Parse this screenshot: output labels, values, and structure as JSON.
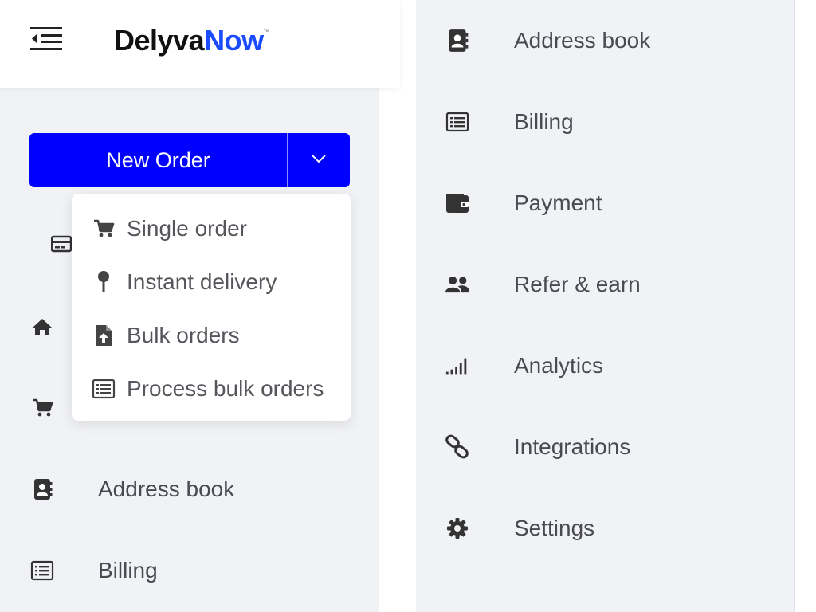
{
  "brand": {
    "part1": "Delyva",
    "part2": "Now",
    "tm": "™",
    "accent": "#1a4bff"
  },
  "new_order": {
    "label": "New Order",
    "bg": "#0000ff"
  },
  "dropdown": {
    "items": [
      {
        "label": "Single order",
        "icon": "cart-icon"
      },
      {
        "label": "Instant delivery",
        "icon": "pin-icon"
      },
      {
        "label": "Bulk orders",
        "icon": "file-upload-icon"
      },
      {
        "label": "Process bulk orders",
        "icon": "list-icon"
      }
    ]
  },
  "sidebar_left": {
    "items": [
      {
        "label": "",
        "icon": "home-icon"
      },
      {
        "label": "",
        "icon": "cart-icon"
      },
      {
        "label": "Address book",
        "icon": "address-book-icon"
      },
      {
        "label": "Billing",
        "icon": "billing-icon"
      }
    ]
  },
  "sidebar_right": {
    "items": [
      {
        "label": "Address book",
        "icon": "address-book-icon"
      },
      {
        "label": "Billing",
        "icon": "billing-icon"
      },
      {
        "label": "Payment",
        "icon": "wallet-icon"
      },
      {
        "label": "Refer & earn",
        "icon": "users-icon"
      },
      {
        "label": "Analytics",
        "icon": "signal-icon"
      },
      {
        "label": "Integrations",
        "icon": "link-icon"
      },
      {
        "label": "Settings",
        "icon": "gear-icon"
      }
    ]
  }
}
